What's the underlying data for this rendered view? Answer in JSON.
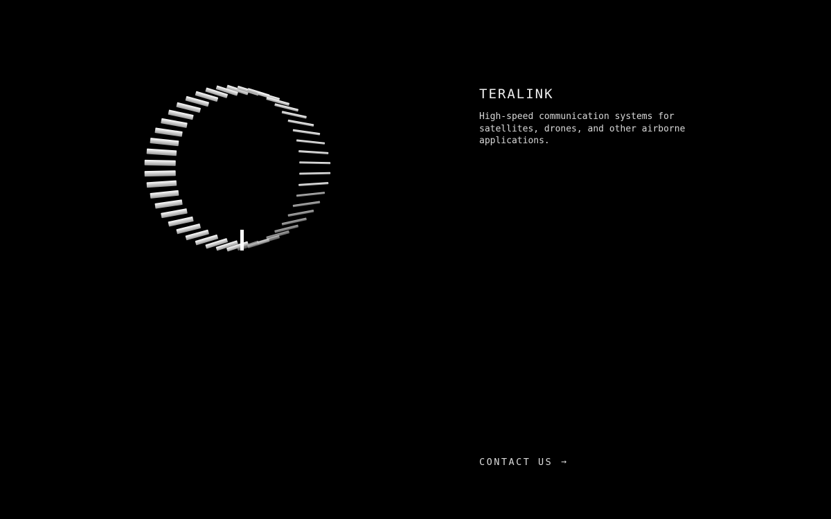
{
  "brand": {
    "title": "TERALINK",
    "tagline": "High-speed communication systems for satellites, drones, and other airborne applications."
  },
  "contact": {
    "label": "CONTACT US",
    "arrow": "→"
  },
  "visual": {
    "icon": "spiral-ring-graphic",
    "color": "#ffffff",
    "background": "#000000"
  }
}
